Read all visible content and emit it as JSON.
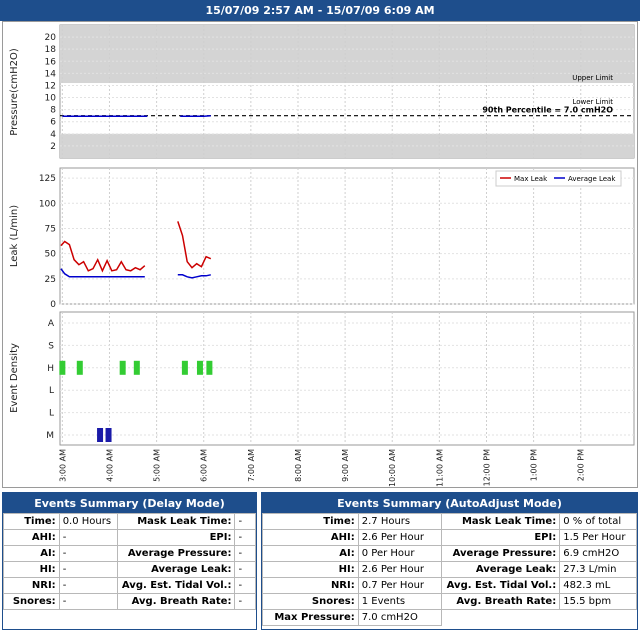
{
  "header": {
    "title": "15/07/09 2:57 AM - 15/07/09 6:09 AM"
  },
  "colors": {
    "header_bg": "#1e4e8c",
    "max_leak": "#cc0000",
    "avg_leak": "#0000cc",
    "event_h": "#33cc33",
    "event_m": "#1a1aa8",
    "limit_band": "#d4d4d4"
  },
  "chart_data": [
    {
      "type": "line",
      "ylabel": "Pressure(cmH2O)",
      "ylim": [
        0,
        22
      ],
      "yticks": [
        2,
        4,
        6,
        8,
        10,
        12,
        14,
        16,
        18,
        20
      ],
      "upper_limit_label": "Upper Limit",
      "lower_limit_label": "Lower Limit",
      "upper_limit_value": 12.4,
      "lower_limit_value": 4,
      "percentile_label": "90th Percentile = 7.0 cmH2O",
      "percentile_value": 7.0,
      "series": [
        {
          "segments": [
            {
              "x": [
                3.0,
                3.5,
                4.0,
                4.5,
                4.8
              ],
              "y": [
                6.9,
                6.9,
                6.9,
                6.9,
                6.9
              ]
            },
            {
              "x": [
                5.5,
                6.0,
                6.15
              ],
              "y": [
                6.9,
                6.9,
                7.0
              ]
            }
          ]
        }
      ]
    },
    {
      "type": "line",
      "ylabel": "Leak (L/min)",
      "ylim": [
        0,
        135
      ],
      "yticks": [
        0,
        25,
        50,
        75,
        100,
        125
      ],
      "legend_position": "top-right",
      "series": [
        {
          "name": "Max Leak",
          "color": "#cc0000",
          "segments": [
            {
              "x": [
                2.97,
                3.05,
                3.15,
                3.25,
                3.35,
                3.45,
                3.55,
                3.65,
                3.75,
                3.85,
                3.95,
                4.05,
                4.15,
                4.25,
                4.35,
                4.45,
                4.55,
                4.65,
                4.75
              ],
              "y": [
                58,
                62,
                59,
                44,
                39,
                42,
                33,
                35,
                44,
                33,
                43,
                33,
                34,
                42,
                34,
                33,
                36,
                34,
                38
              ]
            },
            {
              "x": [
                5.45,
                5.55,
                5.65,
                5.75,
                5.85,
                5.95,
                6.05,
                6.15
              ],
              "y": [
                82,
                68,
                42,
                36,
                40,
                37,
                47,
                45
              ]
            }
          ]
        },
        {
          "name": "Average Leak",
          "color": "#0000cc",
          "segments": [
            {
              "x": [
                2.97,
                3.05,
                3.15,
                3.3,
                3.5,
                3.8,
                4.1,
                4.4,
                4.75
              ],
              "y": [
                35,
                30,
                27,
                27,
                27,
                27,
                27,
                27,
                27
              ]
            },
            {
              "x": [
                5.45,
                5.55,
                5.65,
                5.75,
                5.85,
                5.95,
                6.05,
                6.15
              ],
              "y": [
                29,
                29,
                27,
                26,
                27,
                28,
                28,
                29
              ]
            }
          ]
        }
      ]
    },
    {
      "type": "scatter",
      "ylabel": "Event Density",
      "categories": [
        "A",
        "S",
        "H",
        "L",
        "L",
        "M"
      ],
      "events": [
        {
          "cat": 2,
          "x": 3.0,
          "color": "#33cc33"
        },
        {
          "cat": 2,
          "x": 3.37,
          "color": "#33cc33"
        },
        {
          "cat": 2,
          "x": 4.28,
          "color": "#33cc33"
        },
        {
          "cat": 2,
          "x": 4.58,
          "color": "#33cc33"
        },
        {
          "cat": 2,
          "x": 5.6,
          "color": "#33cc33"
        },
        {
          "cat": 2,
          "x": 5.92,
          "color": "#33cc33"
        },
        {
          "cat": 2,
          "x": 6.12,
          "color": "#33cc33"
        },
        {
          "cat": 5,
          "x": 3.8,
          "color": "#1a1aa8"
        },
        {
          "cat": 5,
          "x": 3.98,
          "color": "#1a1aa8"
        }
      ]
    }
  ],
  "x_axis": {
    "xlim": [
      2.95,
      15.13
    ],
    "ticks": [
      {
        "v": 3,
        "label": "3:00 AM"
      },
      {
        "v": 4,
        "label": "4:00 AM"
      },
      {
        "v": 5,
        "label": "5:00 AM"
      },
      {
        "v": 6,
        "label": "6:00 AM"
      },
      {
        "v": 7,
        "label": "7:00 AM"
      },
      {
        "v": 8,
        "label": "8:00 AM"
      },
      {
        "v": 9,
        "label": "9:00 AM"
      },
      {
        "v": 10,
        "label": "10:00 AM"
      },
      {
        "v": 11,
        "label": "11:00 AM"
      },
      {
        "v": 12,
        "label": "12:00 PM"
      },
      {
        "v": 13,
        "label": "1:00 PM"
      },
      {
        "v": 14,
        "label": "2:00 PM"
      }
    ]
  },
  "summary_delay": {
    "title": "Events Summary (Delay Mode)",
    "rows": [
      {
        "l1": "Time:",
        "v1": "0.0 Hours",
        "l2": "Mask Leak Time:",
        "v2": "-"
      },
      {
        "l1": "AHI:",
        "v1": "-",
        "l2": "EPI:",
        "v2": "-"
      },
      {
        "l1": "AI:",
        "v1": "-",
        "l2": "Average Pressure:",
        "v2": "-"
      },
      {
        "l1": "HI:",
        "v1": "-",
        "l2": "Average Leak:",
        "v2": "-"
      },
      {
        "l1": "NRI:",
        "v1": "-",
        "l2": "Avg. Est. Tidal Vol.:",
        "v2": "-"
      },
      {
        "l1": "Snores:",
        "v1": "-",
        "l2": "Avg. Breath Rate:",
        "v2": "-"
      }
    ]
  },
  "summary_auto": {
    "title": "Events Summary (AutoAdjust Mode)",
    "rows": [
      {
        "l1": "Time:",
        "v1": "2.7 Hours",
        "l2": "Mask Leak Time:",
        "v2": "0 % of total"
      },
      {
        "l1": "AHI:",
        "v1": "2.6 Per Hour",
        "l2": "EPI:",
        "v2": "1.5 Per Hour"
      },
      {
        "l1": "AI:",
        "v1": "0 Per Hour",
        "l2": "Average Pressure:",
        "v2": "6.9 cmH2O"
      },
      {
        "l1": "HI:",
        "v1": "2.6 Per Hour",
        "l2": "Average Leak:",
        "v2": "27.3 L/min"
      },
      {
        "l1": "NRI:",
        "v1": "0.7 Per Hour",
        "l2": "Avg. Est. Tidal Vol.:",
        "v2": "482.3 mL"
      },
      {
        "l1": "Snores:",
        "v1": "1 Events",
        "l2": "Avg. Breath Rate:",
        "v2": "15.5 bpm"
      }
    ],
    "extra_label": "Max Pressure:",
    "extra_value": "7.0 cmH2O"
  }
}
